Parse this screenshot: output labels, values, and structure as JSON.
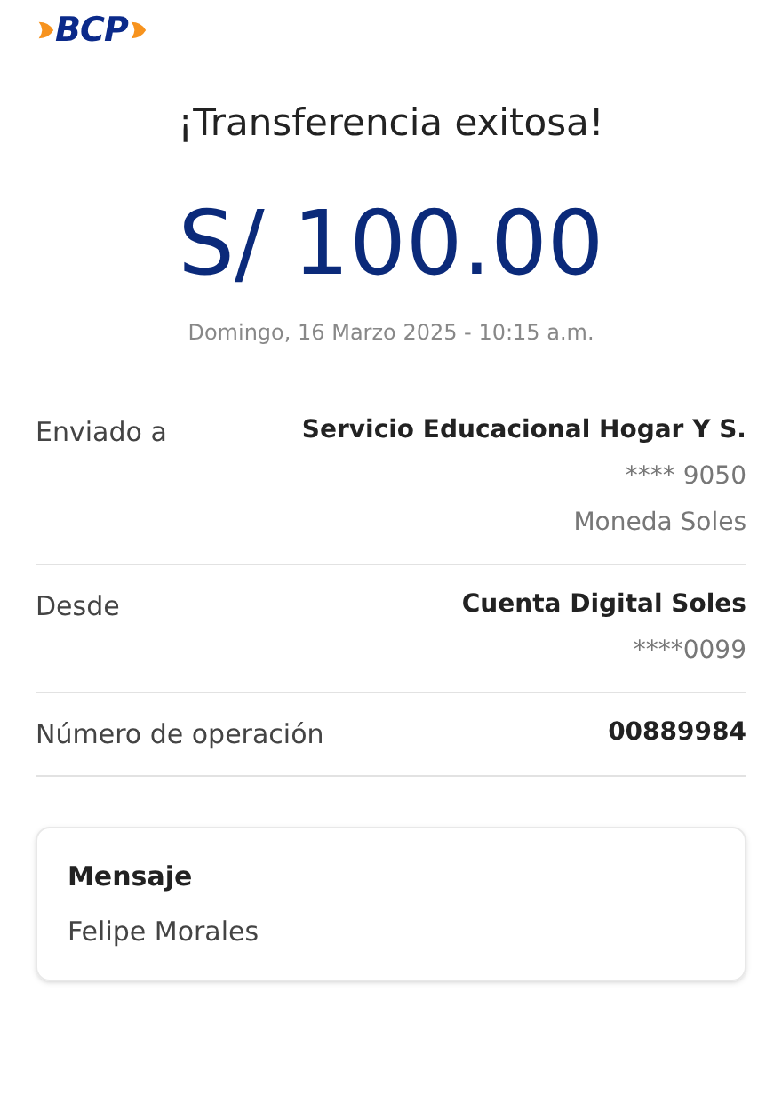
{
  "logo": {
    "text": "BCP"
  },
  "title": "¡Transferencia exitosa!",
  "amount": "S/ 100.00",
  "date": "Domingo, 16 Marzo 2025 - 10:15 a.m.",
  "details": [
    {
      "label": "Enviado a",
      "values": [
        {
          "kind": "strong",
          "text": "Servicio Educacional Hogar Y S."
        },
        {
          "kind": "muted",
          "text": "**** 9050"
        },
        {
          "kind": "muted",
          "text": "Moneda Soles"
        }
      ]
    },
    {
      "label": "Desde",
      "values": [
        {
          "kind": "strong",
          "text": "Cuenta Digital Soles"
        },
        {
          "kind": "muted",
          "text": "****0099"
        }
      ]
    },
    {
      "label": "Número de operación",
      "values": [
        {
          "kind": "strong",
          "text": "00889984"
        }
      ]
    }
  ],
  "message": {
    "title": "Mensaje",
    "text": "Felipe Morales"
  }
}
